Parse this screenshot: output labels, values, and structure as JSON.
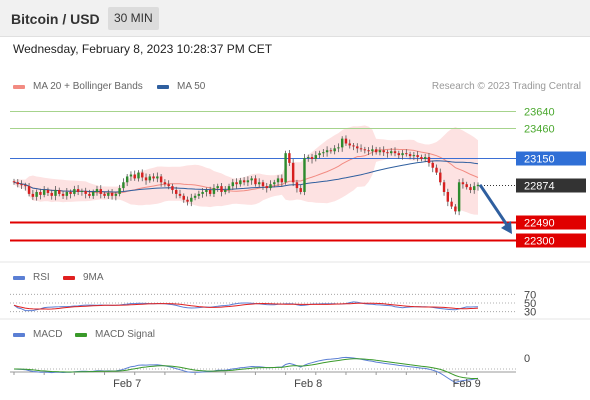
{
  "header": {
    "title": "Bitcoin / USD",
    "interval": "30 MIN"
  },
  "date": "Wednesday, February 8, 2023 10:28:37 PM CET",
  "credit": "Research © 2023 Trading Central",
  "legends": {
    "main": [
      {
        "label": "MA 20 + Bollinger Bands",
        "color": "#f28b82"
      },
      {
        "label": "MA 50",
        "color": "#2f5f9f"
      }
    ],
    "rsi": [
      {
        "label": "RSI",
        "color": "#5b7fd4"
      },
      {
        "label": "9MA",
        "color": "#e02020"
      }
    ],
    "macd": [
      {
        "label": "MACD",
        "color": "#5b7fd4"
      },
      {
        "label": "MACD Signal",
        "color": "#3a9a2a"
      }
    ]
  },
  "chart_data": {
    "type": "candlestick",
    "price_range": [
      22150,
      23800
    ],
    "current_price": 22874,
    "levels": [
      {
        "value": 23640,
        "label": "23640",
        "style": "resistance-green"
      },
      {
        "value": 23460,
        "label": "23460",
        "style": "resistance-green"
      },
      {
        "value": 23150,
        "label": "23150",
        "style": "pivot-blue"
      },
      {
        "value": 22874,
        "label": "22874",
        "style": "current"
      },
      {
        "value": 22490,
        "label": "22490",
        "style": "support-red"
      },
      {
        "value": 22300,
        "label": "22300",
        "style": "support-red"
      }
    ],
    "close_series": [
      22900,
      22880,
      22870,
      22860,
      22780,
      22750,
      22800,
      22770,
      22820,
      22790,
      22760,
      22820,
      22780,
      22760,
      22800,
      22780,
      22830,
      22800,
      22810,
      22780,
      22760,
      22800,
      22830,
      22780,
      22760,
      22790,
      22760,
      22780,
      22840,
      22900,
      22960,
      22980,
      22940,
      23000,
      22950,
      22920,
      22960,
      22940,
      22960,
      22900,
      22880,
      22860,
      22820,
      22780,
      22760,
      22720,
      22700,
      22740,
      22760,
      22780,
      22800,
      22820,
      22780,
      22840,
      22860,
      22800,
      22820,
      22860,
      22900,
      22880,
      22920,
      22900,
      22920,
      22940,
      22880,
      22900,
      22860,
      22840,
      22880,
      22900,
      22940,
      22900,
      23200,
      23100,
      22900,
      22840,
      22800,
      23150,
      23160,
      23140,
      23180,
      23200,
      23210,
      23230,
      23220,
      23250,
      23260,
      23350,
      23300,
      23280,
      23270,
      23250,
      23240,
      23230,
      23220,
      23240,
      23210,
      23230,
      23210,
      23200,
      23220,
      23200,
      23180,
      23200,
      23190,
      23170,
      23180,
      23160,
      23140,
      23160,
      23100,
      23050,
      23000,
      22900,
      22800,
      22700,
      22650,
      22600,
      22900,
      22880,
      22850,
      22820,
      22860,
      22874
    ],
    "rsi_levels": [
      {
        "value": 70,
        "label": "70"
      },
      {
        "value": 50,
        "label": "50"
      },
      {
        "value": 30,
        "label": "30"
      }
    ],
    "macd_levels": [
      {
        "value": 0,
        "label": "0"
      }
    ],
    "x_ticks": [
      {
        "index": 30,
        "label": "Feb 7"
      },
      {
        "index": 78,
        "label": "Feb 8"
      },
      {
        "index": 120,
        "label": "Feb 9"
      }
    ],
    "forecast_arrow": {
      "from": 22874,
      "to": 22490
    }
  }
}
